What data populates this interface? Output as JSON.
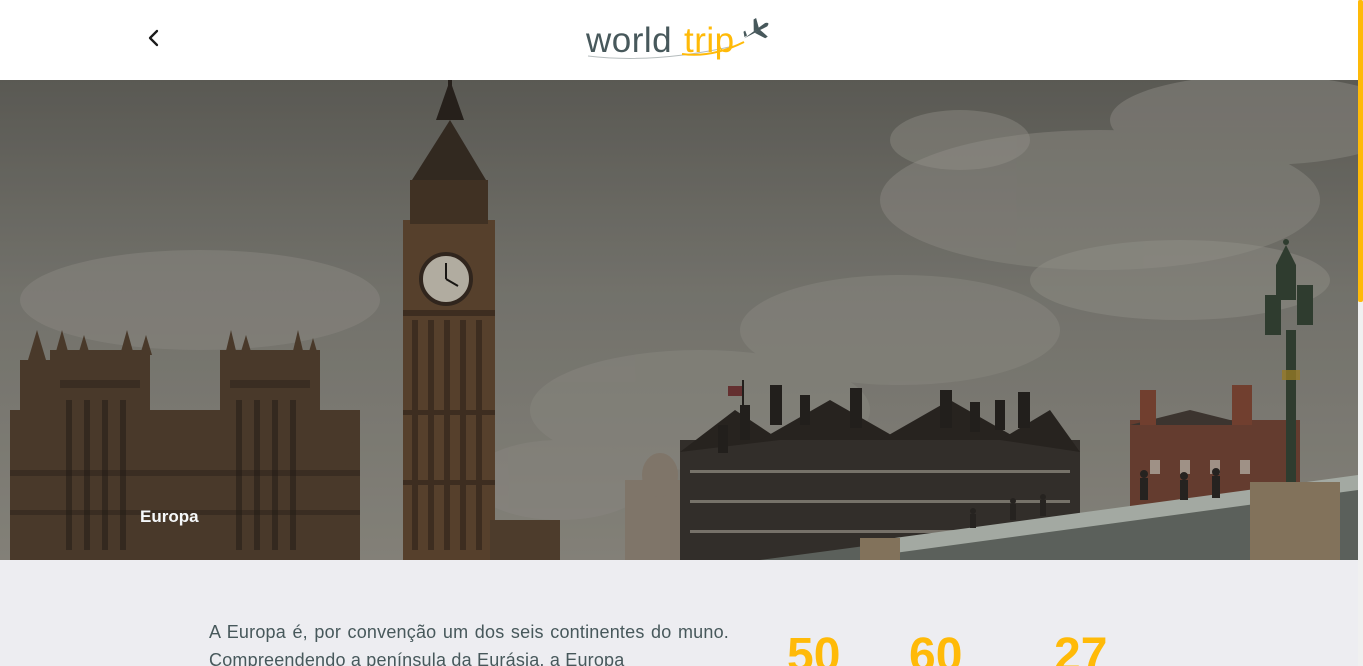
{
  "header": {
    "back_label": "Voltar",
    "logo": {
      "word1": "world",
      "word2": "trip"
    }
  },
  "hero": {
    "title": "Europa"
  },
  "content": {
    "description": "A Europa é, por convenção um dos seis continentes do muno. Compreendendo a península da Eurásia, a Europa",
    "stats": [
      {
        "value": "50"
      },
      {
        "value": "60"
      },
      {
        "value": "27"
      }
    ]
  },
  "colors": {
    "accent": "#ffba08",
    "text": "#47585b",
    "background": "#f5f8fa"
  }
}
